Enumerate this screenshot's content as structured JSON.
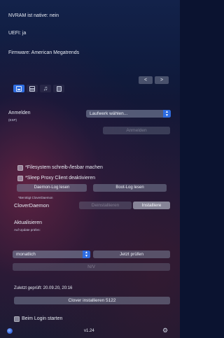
{
  "info": {
    "nvram": "NVRAM ist native: nein",
    "uefi": "UEFI: ja",
    "firmware": "Firmware: American Megatrends"
  },
  "nav": {
    "prev": "<",
    "next": ">"
  },
  "tabs": [
    {
      "name": "disk-tab-icon",
      "active": true
    },
    {
      "name": "table-tab-icon",
      "active": false
    },
    {
      "name": "music-tab-icon",
      "active": false
    },
    {
      "name": "document-tab-icon",
      "active": false
    }
  ],
  "mount": {
    "label": "Anmelden",
    "sublabel": "(ESP)",
    "select_value": "Laufwerk wählen...",
    "mount_button": "Anmelden"
  },
  "options": {
    "filesystem_label": "*Filesystem schreib-/lesbar machen",
    "sleep_proxy_label": "*Sleep Proxy Client deaktivieren",
    "daemon_log_button": "Daemon-Log lesen",
    "boot_log_button": "Boot-Log lesen",
    "note": "*Benötigt CloverDaemon"
  },
  "daemon": {
    "label": "CloverDaemon",
    "uninstall_button": "Deinstallieren",
    "install_button": "Installiere"
  },
  "update": {
    "heading": "Aktualisieren",
    "subheading": "Auf Update prüfen:",
    "frequency": "monatlich",
    "check_button": "Jetzt prüfen",
    "na_value": "N/V",
    "last_checked": "Zuletzt geprüft: 20.09.20, 20:16",
    "install_button": "Clover installieren 5122"
  },
  "footer": {
    "login_label": "Beim Login starten",
    "version": "v1.24"
  }
}
